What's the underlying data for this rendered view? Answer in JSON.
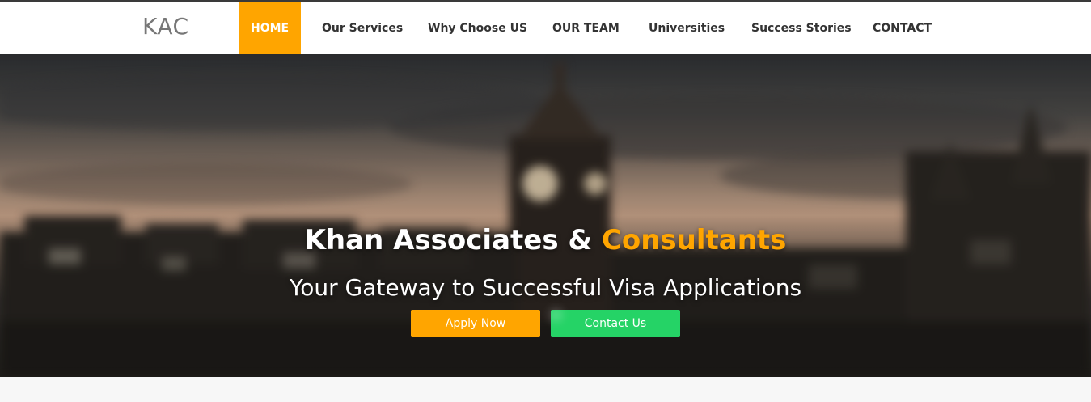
{
  "brand": {
    "name": "KAC"
  },
  "nav": {
    "items": [
      {
        "label": "HOME",
        "active": true
      },
      {
        "label": "Our Services",
        "active": false
      },
      {
        "label": "Why Choose US",
        "active": false
      },
      {
        "label": "OUR TEAM",
        "active": false
      },
      {
        "label": "Universities",
        "active": false
      },
      {
        "label": "Success Stories",
        "active": false
      },
      {
        "label": "CONTACT",
        "active": false
      }
    ]
  },
  "hero": {
    "title_main": "Khan Associates &",
    "title_accent": "Consultants",
    "subtitle": "Your Gateway to Successful Visa Applications",
    "apply_button": "Apply Now",
    "contact_button": "Contact Us",
    "contact_icon": "whatsapp-icon"
  },
  "colors": {
    "accent": "#ffa500",
    "whatsapp_green": "#25d366",
    "nav_text": "#333333",
    "brand_text": "#777777"
  }
}
